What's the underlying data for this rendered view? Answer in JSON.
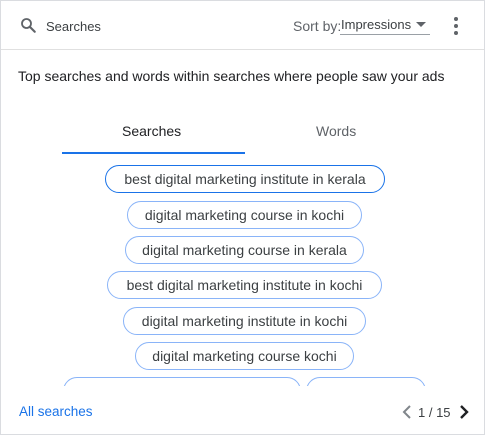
{
  "header": {
    "title": "Searches",
    "sort_label": "Sort by:",
    "sort_value": "Impressions",
    "icons": {
      "search": "search-icon",
      "sort": "caret-down-icon",
      "more": "more-vert-icon"
    }
  },
  "description": "Top searches and words within searches where people saw your ads",
  "tabs": [
    {
      "label": "Searches",
      "active": true
    },
    {
      "label": "Words",
      "active": false
    }
  ],
  "chips": [
    "best digital marketing institute in kerala",
    "digital marketing course in kochi",
    "digital marketing course in kerala",
    "best digital marketing institute in kochi",
    "digital marketing institute in kochi",
    "digital marketing course kochi",
    "",
    ""
  ],
  "footer": {
    "link": "All searches",
    "pagination": "1 / 15",
    "icons": {
      "prev": "chevron-left-icon",
      "next": "chevron-right-icon"
    }
  },
  "colors": {
    "accent": "#1a73e8",
    "chip_border": "#8ab4f8",
    "text": "#202124",
    "muted": "#5f6368"
  }
}
